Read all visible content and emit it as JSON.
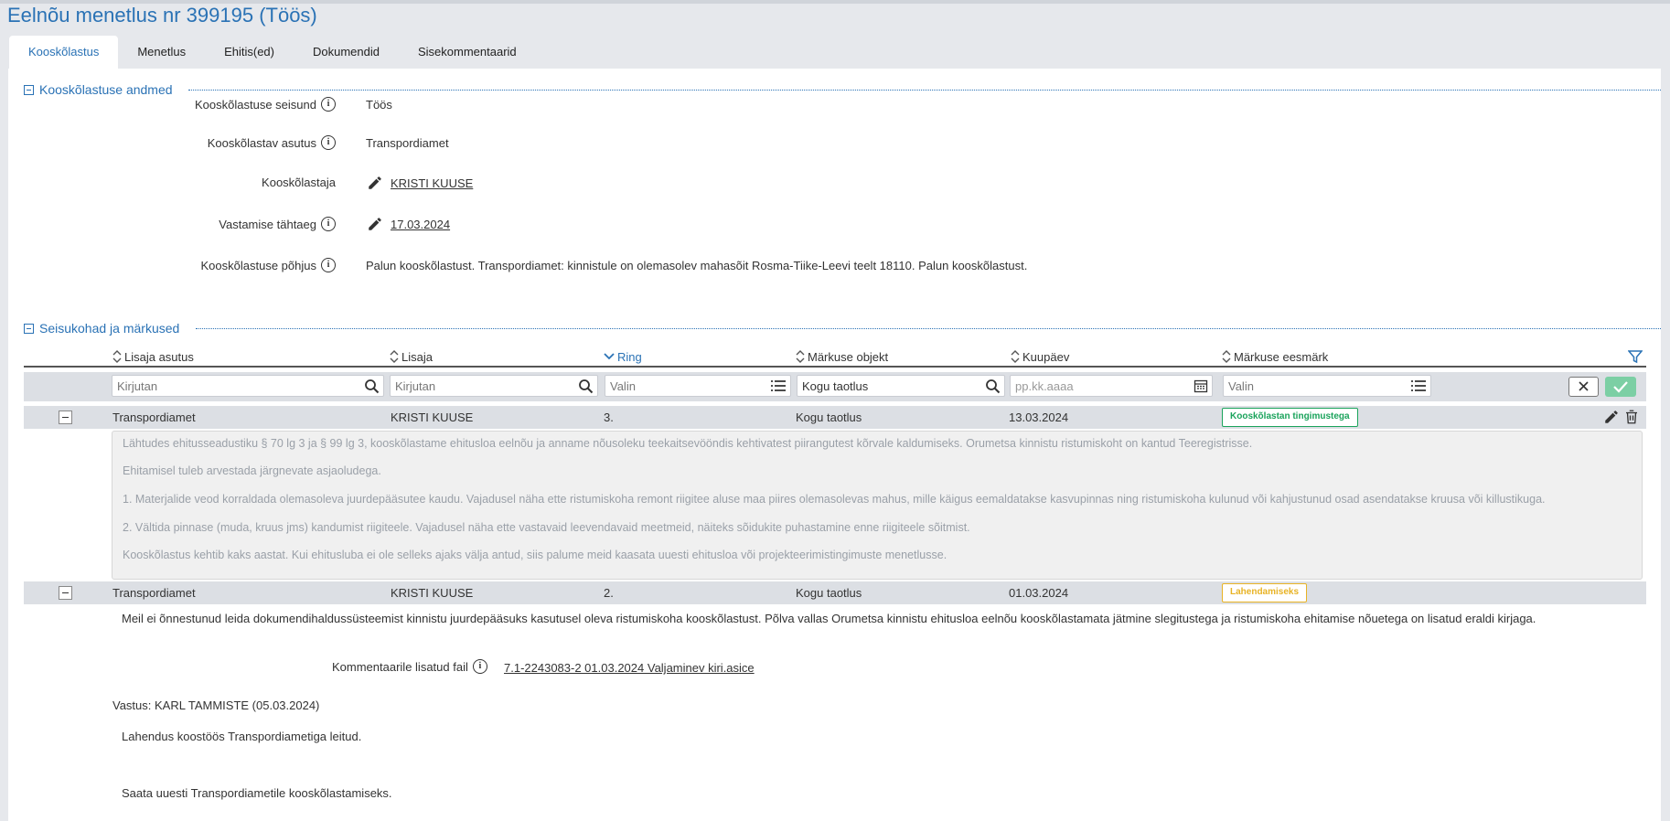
{
  "page": {
    "title": "Eelnõu menetlus nr 399195 (Töös)"
  },
  "tabs": [
    "Kooskõlastus",
    "Menetlus",
    "Ehitis(ed)",
    "Dokumendid",
    "Sisekommentaarid"
  ],
  "section1": {
    "title": "Kooskõlastuse andmed",
    "fields": [
      {
        "label": "Kooskõlastuse seisund",
        "value": "Töös"
      },
      {
        "label": "Kooskõlastav asutus",
        "value": "Transpordiamet"
      },
      {
        "label": "Kooskõlastaja",
        "value": "KRISTI KUUSE"
      },
      {
        "label": "Vastamise tähtaeg",
        "value": "17.03.2024"
      },
      {
        "label": "Kooskõlastuse põhjus",
        "value": "Palun kooskõlastust. Transpordiamet: kinnistule on olemasolev mahasõit Rosma-Tiike-Leevi teelt 18110. Palun kooskõlastust."
      }
    ]
  },
  "section2": {
    "title": "Seisukohad ja märkused",
    "columns": [
      "Lisaja asutus",
      "Lisaja",
      "Ring",
      "Märkuse objekt",
      "Kuupäev",
      "Märkuse eesmärk"
    ],
    "filters": {
      "asutus": "Kirjutan",
      "lisaja": "Kirjutan",
      "ring": "Valin",
      "objekt": "Kogu taotlus",
      "kuupaev": "pp.kk.aaaa",
      "eesmark": "Valin"
    },
    "rows": [
      {
        "asutus": "Transpordiamet",
        "lisaja": "KRISTI KUUSE",
        "ring": "3.",
        "objekt": "Kogu taotlus",
        "kuupaev": "13.03.2024",
        "eesmark": "Kooskõlastan tingimustega",
        "lines": [
          "Lähtudes ehitusseadustiku § 70 lg 3 ja § 99 lg 3, kooskõlastame ehitusloa eelnõu ja anname nõusoleku teekaitsevööndis kehtivatest piirangutest kõrvale kaldumiseks. Orumetsa kinnistu ristumiskoht on kantud Teeregistrisse.",
          "Ehitamisel tuleb arvestada järgnevate asjaoludega.",
          "1. Materjalide veod korraldada olemasoleva juurdepääsutee kaudu. Vajadusel näha ette ristumiskoha remont riigitee aluse maa piires olemasolevas mahus, mille käigus eemaldatakse kasvupinnas ning ristumiskoha kulunud või kahjustunud osad asendatakse kruusa või killustikuga.",
          "2. Vältida pinnase (muda, kruus jms) kandumist riigiteele. Vajadusel näha ette vastavaid leevendavaid meetmeid, näiteks sõidukite puhastamine enne riigiteele sõitmist.",
          "Kooskõlastus kehtib kaks aastat. Kui ehitusluba ei ole selleks ajaks välja antud, siis palume meid kaasata uuesti ehitusloa või projekteerimistingimuste menetlusse."
        ]
      },
      {
        "asutus": "Transpordiamet",
        "lisaja": "KRISTI KUUSE",
        "ring": "2.",
        "objekt": "Kogu taotlus",
        "kuupaev": "01.03.2024",
        "eesmark": "Lahendamiseks",
        "text": "Meil ei õnnestunud leida dokumendihaldussüsteemist kinnistu juurdepääsuks kasutusel oleva ristumiskoha kooskõlastust. Põlva vallas Orumetsa kinnistu ehitusloa eelnõu kooskõlastamata jätmine slegitustega ja ristumiskoha ehitamise nõuetega on lisatud eraldi kirjaga.",
        "file_label": "Kommentaarile lisatud fail",
        "file_name": "7.1-2243083-2 01.03.2024 Valjaminev kiri.asice",
        "vastus": "Vastus: KARL TAMMISTE (05.03.2024)",
        "answer_lines": [
          "Lahendus koostöös Transpordiametiga leitud.",
          "Saata uuesti Transpordiametile kooskõlastamiseks."
        ]
      }
    ]
  },
  "colors": {
    "accent": "#2a72b5",
    "green": "#1aa35b",
    "yellow": "#e8b325"
  }
}
